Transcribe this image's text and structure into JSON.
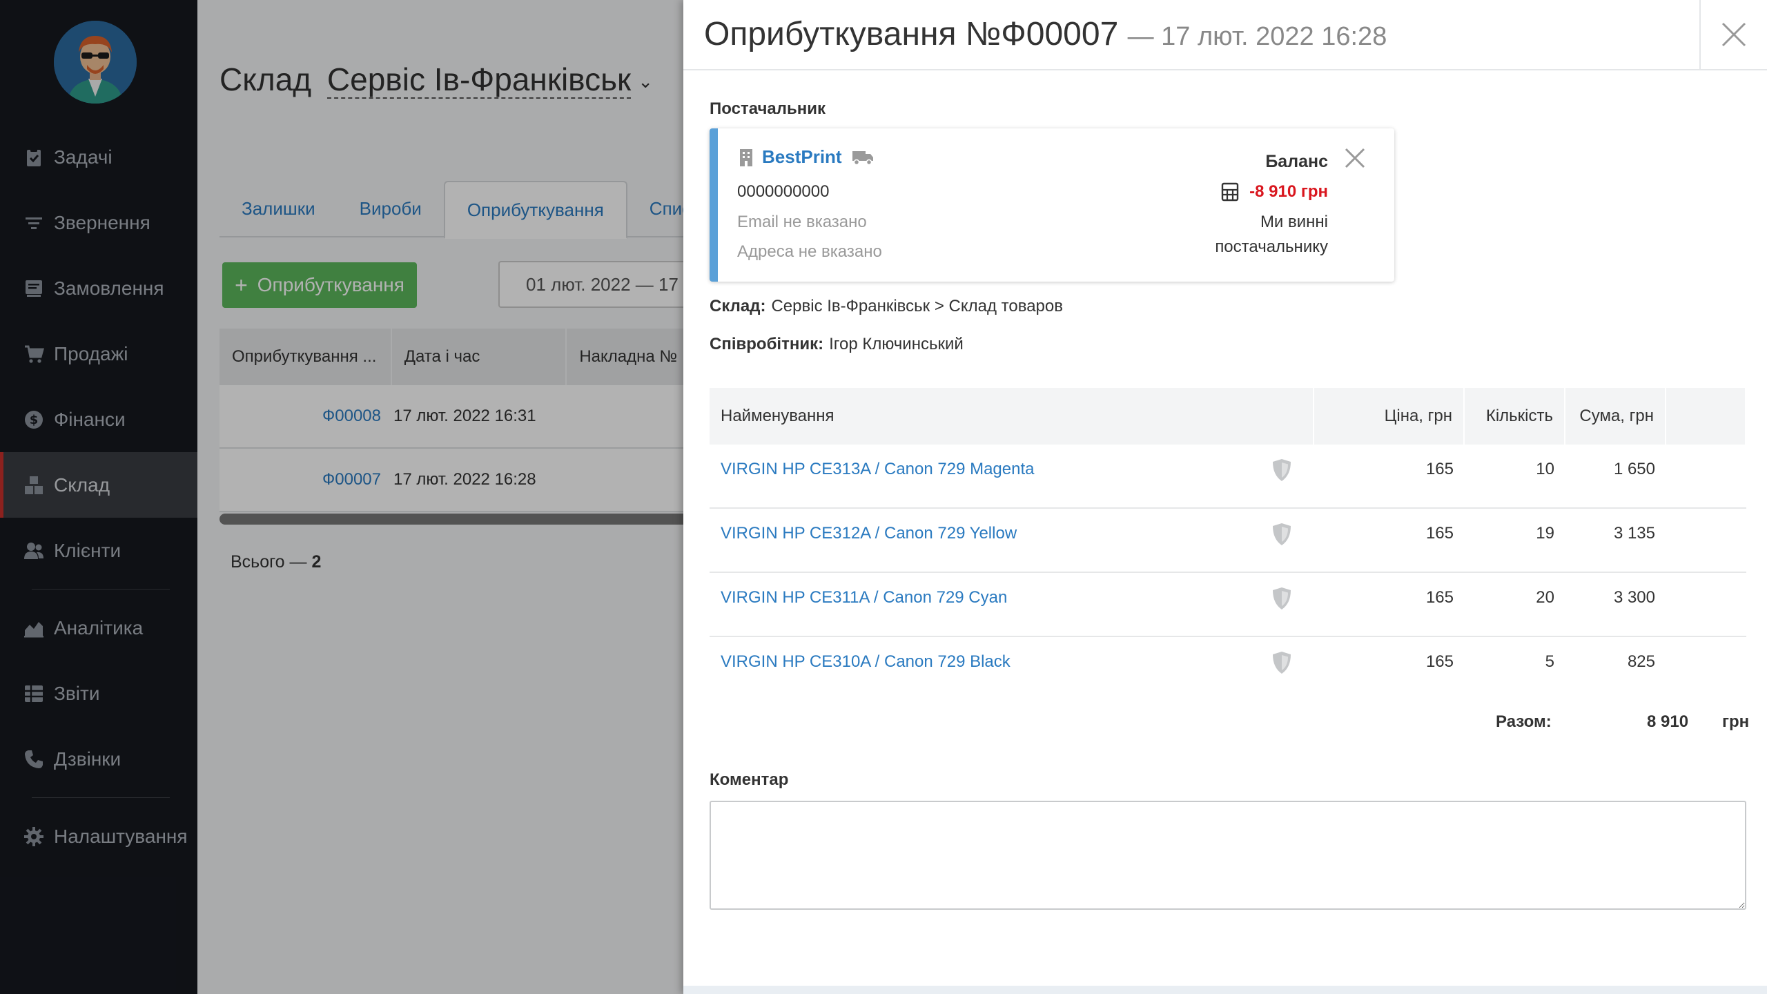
{
  "sidebar": {
    "items": [
      {
        "label": "Задачі",
        "icon": "clipboard-icon"
      },
      {
        "label": "Звернення",
        "icon": "filter-icon"
      },
      {
        "label": "Замовлення",
        "icon": "order-icon"
      },
      {
        "label": "Продажі",
        "icon": "cart-icon"
      },
      {
        "label": "Фінанси",
        "icon": "dollar-icon"
      },
      {
        "label": "Склад",
        "icon": "boxes-icon",
        "active": true
      },
      {
        "label": "Клієнти",
        "icon": "users-icon"
      },
      {
        "label": "Аналітика",
        "icon": "chart-icon"
      },
      {
        "label": "Звіти",
        "icon": "table-icon"
      },
      {
        "label": "Дзвінки",
        "icon": "phone-icon"
      },
      {
        "label": "Налаштування",
        "icon": "gear-icon"
      }
    ]
  },
  "page": {
    "title_prefix": "Склад",
    "store": "Сервіс Ів-Франківськ",
    "tabs": [
      "Залишки",
      "Вироби",
      "Оприбуткування",
      "Спис"
    ],
    "add_button": "Оприбуткування",
    "date_range": "01 лют. 2022 — 17",
    "table_headers": [
      "Оприбуткування ...",
      "Дата і час",
      "Накладна №"
    ],
    "rows": [
      {
        "id": "Ф00008",
        "date": "17 лют. 2022 16:31"
      },
      {
        "id": "Ф00007",
        "date": "17 лют. 2022 16:28"
      }
    ],
    "total_label": "Всього —",
    "total_count": "2"
  },
  "modal": {
    "title": "Оприбуткування №Ф00007",
    "subtitle": "— 17 лют. 2022 16:28",
    "supplier_label": "Постачальник",
    "supplier": {
      "name": "BestPrint",
      "phone": "0000000000",
      "email": "Email не вказано",
      "address": "Адреса не вказано",
      "balance_label": "Баланс",
      "balance_value": "-8 910 грн",
      "balance_note": "Ми винні постачальнику"
    },
    "warehouse_label": "Склад:",
    "warehouse_value": "Сервіс Ів-Франківськ > Склад товаров",
    "employee_label": "Співробітник:",
    "employee_value": "Ігор Ключинський",
    "items_headers": {
      "name": "Найменування",
      "price": "Ціна, грн",
      "qty": "Кількість",
      "sum": "Сума, грн"
    },
    "items": [
      {
        "name": "VIRGIN HP CE313A / Canon 729 Magenta",
        "price": "165",
        "qty": "10",
        "sum": "1 650"
      },
      {
        "name": "VIRGIN HP CE312A / Canon 729 Yellow",
        "price": "165",
        "qty": "19",
        "sum": "3 135"
      },
      {
        "name": "VIRGIN HP CE311A / Canon 729 Cyan",
        "price": "165",
        "qty": "20",
        "sum": "3 300"
      },
      {
        "name": "VIRGIN HP CE310A / Canon 729 Black",
        "price": "165",
        "qty": "5",
        "sum": "825"
      }
    ],
    "total_label": "Разом:",
    "total_value": "8 910",
    "total_currency": "грн",
    "comment_label": "Коментар",
    "comment_value": ""
  },
  "colors": {
    "accent": "#2a7ac0",
    "add_button": "#5cb85c",
    "balance_negative": "#d9161e",
    "active_marker": "#c9302c",
    "card_border": "#5aa0d8"
  }
}
